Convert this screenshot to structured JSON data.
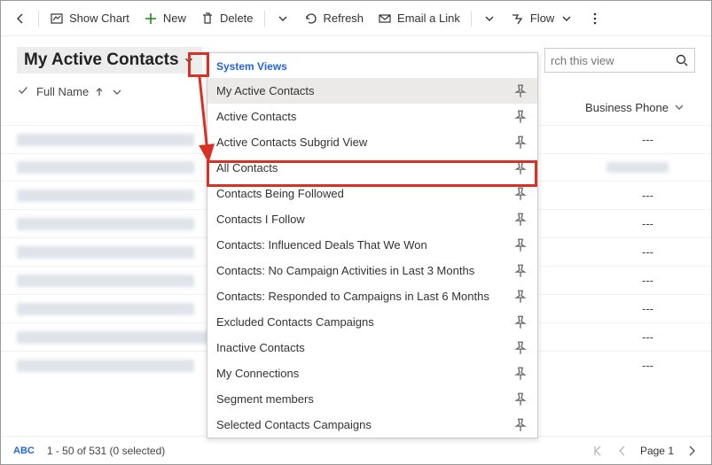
{
  "toolbar": {
    "showChart": "Show Chart",
    "new": "New",
    "delete": "Delete",
    "refresh": "Refresh",
    "email": "Email a Link",
    "flow": "Flow"
  },
  "header": {
    "viewTitle": "My Active Contacts",
    "searchPlaceholder": "Search this view",
    "searchVisible": "rch this view"
  },
  "columns": {
    "fullName": "Full Name",
    "businessPhone": "Business Phone"
  },
  "dropdown": {
    "sectionTitle": "System Views",
    "selected": "My Active Contacts",
    "highlighted": "All Contacts",
    "items": [
      "My Active Contacts",
      "Active Contacts",
      "Active Contacts Subgrid View",
      "All Contacts",
      "Contacts Being Followed",
      "Contacts I Follow",
      "Contacts: Influenced Deals That We Won",
      "Contacts: No Campaign Activities in Last 3 Months",
      "Contacts: Responded to Campaigns in Last 6 Months",
      "Excluded Contacts Campaigns",
      "Inactive Contacts",
      "My Connections",
      "Segment members",
      "Selected Contacts Campaigns"
    ]
  },
  "grid": {
    "placeholderBP": "---",
    "rows": 9
  },
  "status": {
    "abc": "ABC",
    "records": "1 - 50 of 531 (0 selected)",
    "pageLabel": "Page 1"
  }
}
